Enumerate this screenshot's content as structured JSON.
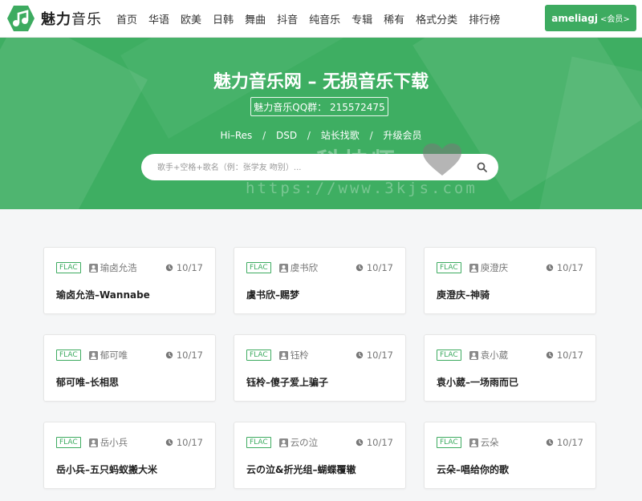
{
  "brand": {
    "name_bold": "魅力",
    "name_light": "音乐"
  },
  "nav": [
    "首页",
    "华语",
    "欧美",
    "日韩",
    "舞曲",
    "抖音",
    "纯音乐",
    "专辑",
    "稀有",
    "格式分类",
    "排行榜"
  ],
  "user": {
    "name": "ameliagj",
    "role": "<会员>"
  },
  "hero": {
    "title": "魅力音乐网 – 无损音乐下载",
    "qq": "魅力音乐QQ群： 215572475",
    "links": [
      "Hi–Res",
      "DSD",
      "站长找歌",
      "升级会员"
    ],
    "separator": "/",
    "search_placeholder": "歌手+空格+歌名（例：张学友 吻别）..."
  },
  "watermark": {
    "text": "科技师",
    "url": "https://www.3kjs.com"
  },
  "cards": [
    {
      "format": "FLAC",
      "artist": "瑜卤允浩",
      "date": "10/17",
      "title": "瑜卤允浩–Wannabe"
    },
    {
      "format": "FLAC",
      "artist": "虞书欣",
      "date": "10/17",
      "title": "虞书欣–赐梦"
    },
    {
      "format": "FLAC",
      "artist": "庾澄庆",
      "date": "10/17",
      "title": "庾澄庆–神骑"
    },
    {
      "format": "FLAC",
      "artist": "郁可唯",
      "date": "10/17",
      "title": "郁可唯–长相思"
    },
    {
      "format": "FLAC",
      "artist": "钰柃",
      "date": "10/17",
      "title": "钰柃–傻子爱上骗子"
    },
    {
      "format": "FLAC",
      "artist": "袁小葳",
      "date": "10/17",
      "title": "袁小葳–一场雨而已"
    },
    {
      "format": "FLAC",
      "artist": "岳小兵",
      "date": "10/17",
      "title": "岳小兵–五只蚂蚁搬大米"
    },
    {
      "format": "FLAC",
      "artist": "云の泣",
      "date": "10/17",
      "title": "云の泣&折光组–蝴蝶覆辙"
    },
    {
      "format": "FLAC",
      "artist": "云朵",
      "date": "10/17",
      "title": "云朵–唱给你的歌"
    }
  ],
  "colors": {
    "accent": "#3dab60",
    "hero_bg": "#3eae62"
  },
  "icons": {
    "logo": "music-note-logo-icon",
    "search": "search-icon",
    "artist": "user-icon",
    "date": "clock-icon"
  }
}
